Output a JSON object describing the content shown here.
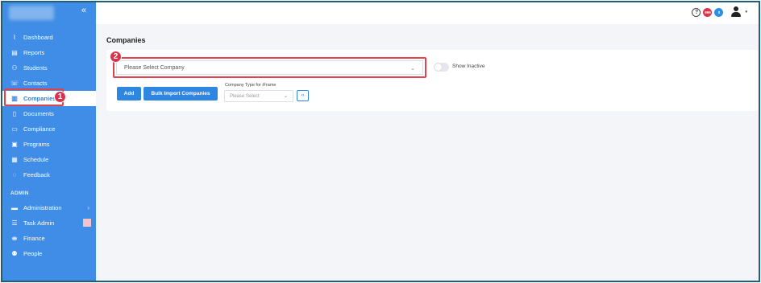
{
  "sidebar": {
    "collapse_icon": "«",
    "items": [
      {
        "label": "Dashboard",
        "icon": "dashboard-icon",
        "glyph": "⌇"
      },
      {
        "label": "Reports",
        "icon": "reports-icon",
        "glyph": "▤"
      },
      {
        "label": "Students",
        "icon": "students-icon",
        "glyph": "⚇"
      },
      {
        "label": "Contacts",
        "icon": "contacts-icon",
        "glyph": "☏"
      },
      {
        "label": "Companies",
        "icon": "companies-icon",
        "glyph": "▥"
      },
      {
        "label": "Documents",
        "icon": "documents-icon",
        "glyph": "▯"
      },
      {
        "label": "Compliance",
        "icon": "compliance-icon",
        "glyph": "▭"
      },
      {
        "label": "Programs",
        "icon": "programs-icon",
        "glyph": "▣"
      },
      {
        "label": "Schedule",
        "icon": "schedule-icon",
        "glyph": "▦"
      },
      {
        "label": "Feedback",
        "icon": "feedback-icon",
        "glyph": "◌"
      }
    ],
    "admin_title": "ADMIN",
    "admin_items": [
      {
        "label": "Administration",
        "icon": "administration-icon",
        "glyph": "▬",
        "chevron": "›"
      },
      {
        "label": "Task Admin",
        "icon": "task-admin-icon",
        "glyph": "☰"
      },
      {
        "label": "Finance",
        "icon": "finance-icon",
        "glyph": "⛂"
      },
      {
        "label": "People",
        "icon": "people-icon",
        "glyph": "⚉"
      }
    ]
  },
  "topbar": {
    "help_icon": "?",
    "badge_red": "999",
    "badge_blue": "0",
    "user_caret": "▾"
  },
  "main": {
    "title": "Companies",
    "company_select": {
      "placeholder": "Please Select Company",
      "caret": "⌄"
    },
    "show_inactive_label": "Show Inactive",
    "add_label": "Add",
    "bulk_import_label": "Bulk Import Companies",
    "company_type_label": "Company Type for iFrame",
    "company_type_select": {
      "placeholder": "Please Select",
      "caret": "⌄"
    },
    "code_icon_glyph": "‹›"
  },
  "annotations": {
    "marker1": "1",
    "marker2": "2"
  },
  "colors": {
    "sidebar": "#3f8de6",
    "accent": "#2f86e0",
    "annotation": "#e0424e",
    "active_text": "#2f7fdb"
  }
}
